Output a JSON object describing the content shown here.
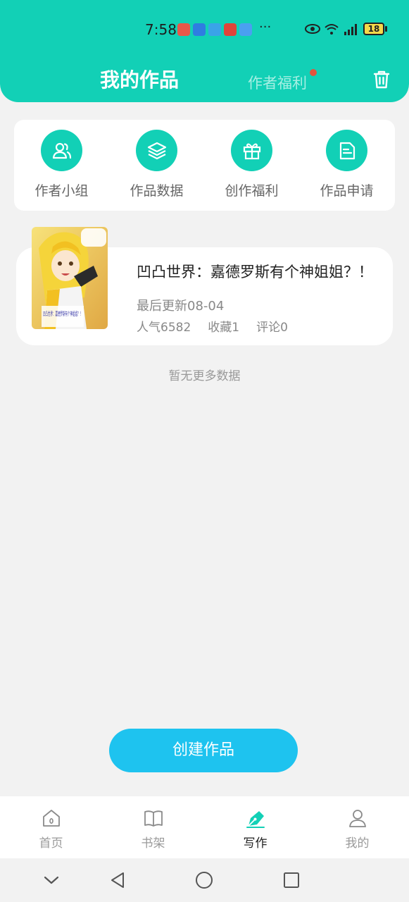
{
  "status_bar": {
    "time": "7:58",
    "more": "···",
    "battery": "18"
  },
  "header": {
    "title": "我的作品",
    "tab": "作者福利"
  },
  "menu": {
    "items": [
      {
        "label": "作者小组",
        "icon": "people-icon"
      },
      {
        "label": "作品数据",
        "icon": "layers-icon"
      },
      {
        "label": "创作福利",
        "icon": "gift-icon"
      },
      {
        "label": "作品申请",
        "icon": "document-icon"
      }
    ]
  },
  "work": {
    "title": "凹凸世界：嘉德罗斯有个神姐姐？！",
    "last_update": "最后更新08-04",
    "popularity": "人气6582",
    "favorites": "收藏1",
    "comments": "评论0",
    "cover_text": "凹凸世界：嘉德罗斯有个神姐姐？！"
  },
  "list_footer": "暂无更多数据",
  "create_button": "创建作品",
  "bottom_nav": {
    "items": [
      {
        "label": "首页",
        "icon": "home-icon"
      },
      {
        "label": "书架",
        "icon": "book-icon"
      },
      {
        "label": "写作",
        "icon": "pen-icon"
      },
      {
        "label": "我的",
        "icon": "person-icon"
      }
    ],
    "active_index": 2
  },
  "colors": {
    "accent": "#12d0b6",
    "button": "#1ec3ef",
    "badge": "#e4543c"
  }
}
